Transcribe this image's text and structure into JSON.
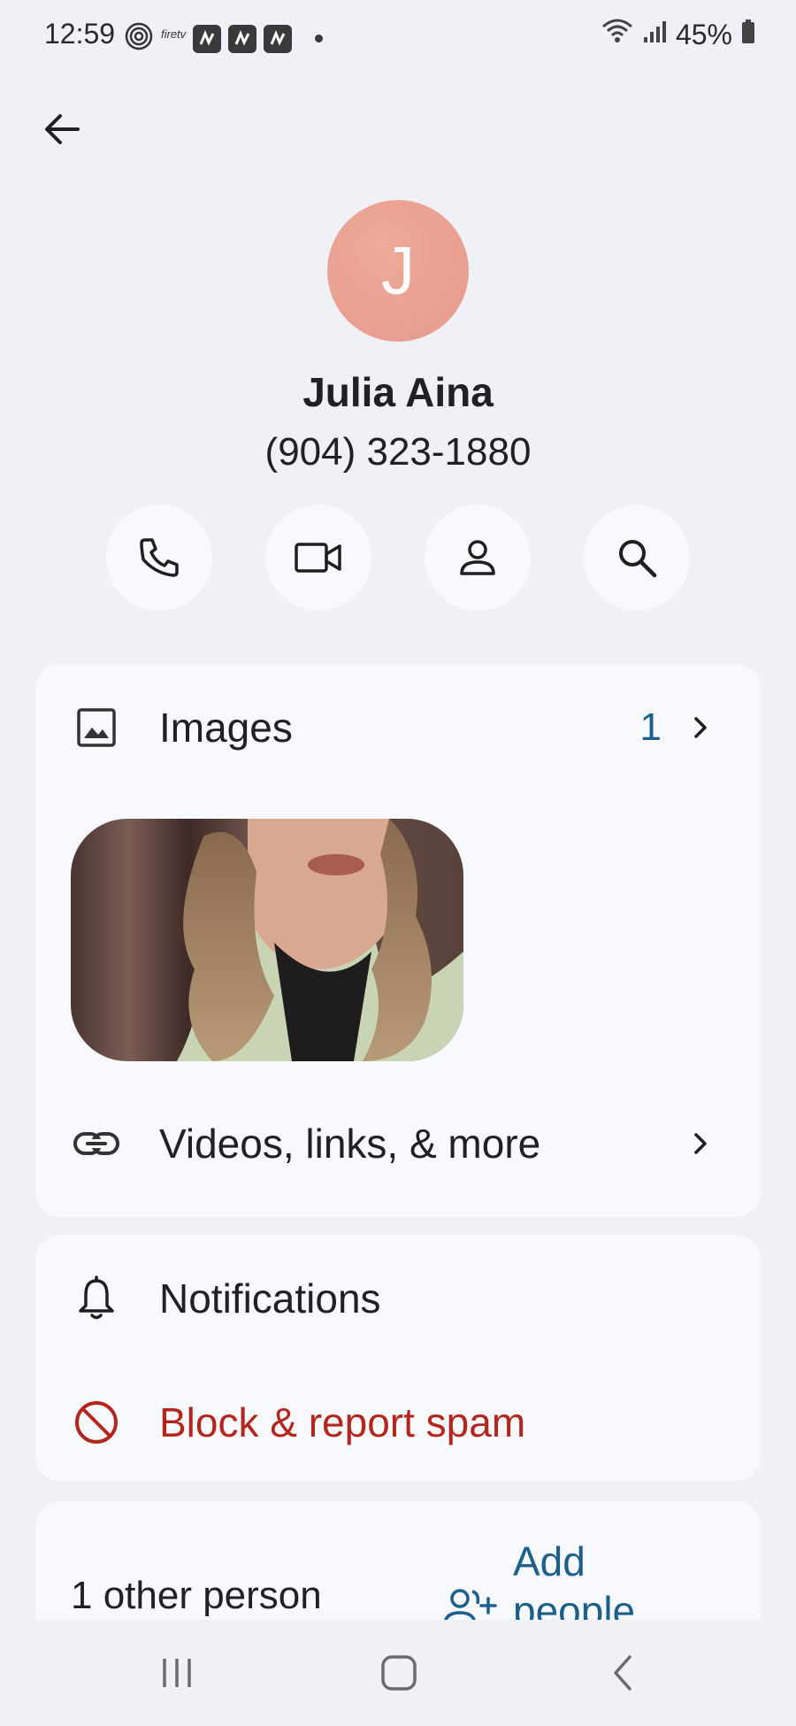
{
  "status_bar": {
    "time": "12:59",
    "firetv_label": "firetv",
    "battery": "45%"
  },
  "contact": {
    "initial": "J",
    "name": "Julia Aina",
    "phone": "(904) 323-1880",
    "avatar_color": "#e9a090"
  },
  "actions": [
    {
      "icon": "phone-icon"
    },
    {
      "icon": "video-icon"
    },
    {
      "icon": "person-icon"
    },
    {
      "icon": "search-icon"
    }
  ],
  "media": {
    "images_label": "Images",
    "images_count": "1",
    "videos_label": "Videos, links, & more"
  },
  "settings": {
    "notifications_label": "Notifications",
    "block_label": "Block & report spam",
    "block_color": "#b3261e"
  },
  "people": {
    "other_person_label": "1 other person",
    "add_people_label": "Add people"
  },
  "colors": {
    "accent": "#1c5f8a",
    "background": "#eff1f6",
    "card": "#f7f9fd"
  }
}
